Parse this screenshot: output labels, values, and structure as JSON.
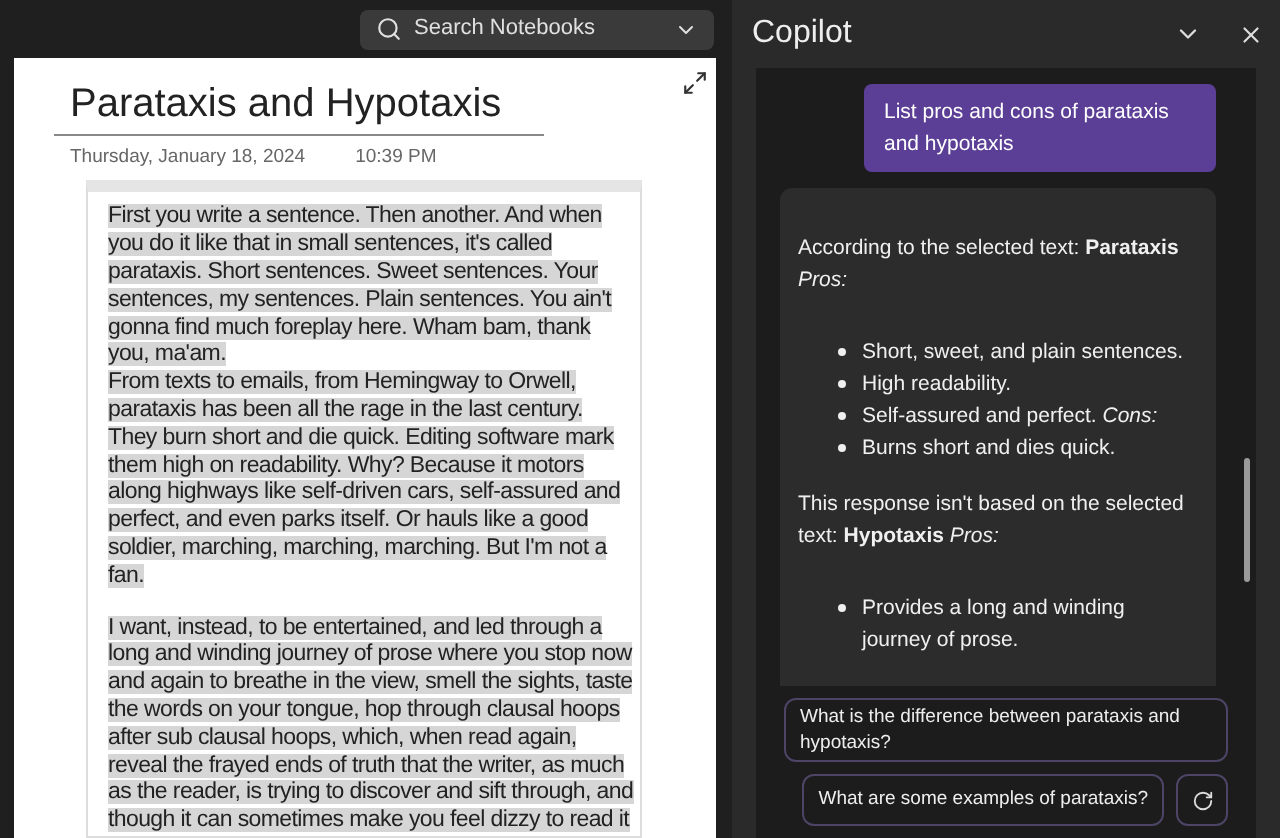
{
  "search": {
    "placeholder": "Search Notebooks"
  },
  "note": {
    "title": "Parataxis and Hypotaxis",
    "date": "Thursday, January 18, 2024",
    "time": "10:39 PM",
    "paragraphs": [
      "First you write a sentence. Then another. And when you do it like that in small sentences, it's called parataxis. Short sentences. Sweet sentences. Your sentences, my sentences. Plain sentences. You ain't gonna find much foreplay here. Wham bam, thank you, ma'am.",
      "From texts to emails, from Hemingway to Orwell, parataxis has been all the rage in the last century. They burn short and die quick. Editing software mark them high on readability. Why? Because it motors along highways like self-driven cars, self-assured and perfect, and even parks itself. Or hauls like a good soldier, marching, marching, marching. But I'm not a fan.",
      "I want, instead, to be entertained, and led through a long and winding journey of prose where you stop now and again to breathe in the view, smell the sights, taste the words on your tongue, hop through clausal hoops after sub clausal hoops, which, when read again, reveal the frayed ends of truth that the writer, as much as the reader, is trying to discover and sift through, and though it can sometimes make you feel dizzy to read it"
    ]
  },
  "copilot": {
    "title": "Copilot",
    "user_message": "List pros and cons of parataxis and hypotaxis",
    "response": [
      {
        "kind": "text",
        "text": "According to the selected text: **Parataxis** *Pros:*"
      },
      {
        "kind": "list",
        "items": [
          "Short, sweet, and plain sentences.",
          "High readability.",
          "Self-assured and perfect. *Cons:*",
          "Burns short and dies quick."
        ]
      },
      {
        "kind": "text",
        "text": "This response isn't based on the selected text: **Hypotaxis** *Pros:*"
      },
      {
        "kind": "list",
        "items": [
          "Provides a long and winding journey of prose."
        ]
      }
    ],
    "suggestions": [
      "What is the difference between parataxis and hypotaxis?",
      "What are some examples of parataxis?"
    ]
  }
}
